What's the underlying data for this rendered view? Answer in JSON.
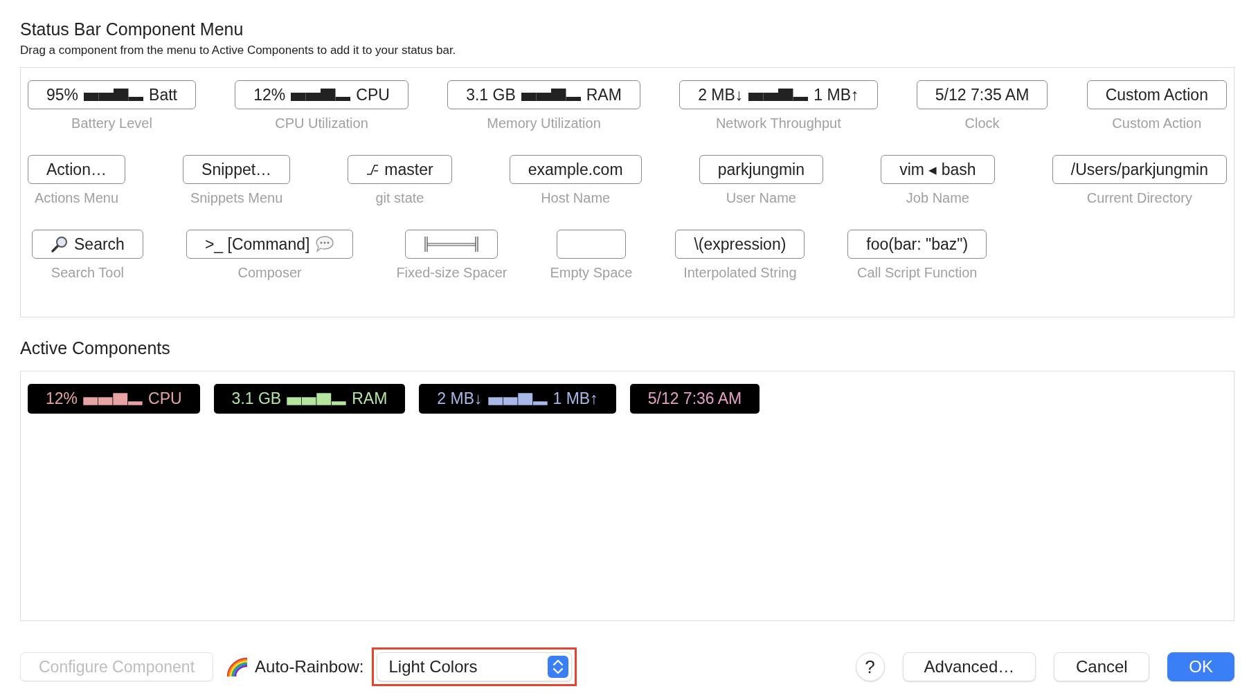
{
  "title": "Status Bar Component Menu",
  "subtitle": "Drag a component from the menu to Active Components to add it to your status bar.",
  "palette_rows": [
    {
      "items": [
        {
          "label": "Battery Level",
          "chip": [
            {
              "kind": "text",
              "text": "95%"
            },
            {
              "kind": "sparkline"
            },
            {
              "kind": "text",
              "text": "Batt"
            }
          ]
        },
        {
          "label": "CPU Utilization",
          "chip": [
            {
              "kind": "text",
              "text": "12%"
            },
            {
              "kind": "sparkline"
            },
            {
              "kind": "text",
              "text": "CPU"
            }
          ]
        },
        {
          "label": "Memory Utilization",
          "chip": [
            {
              "kind": "text",
              "text": "3.1 GB"
            },
            {
              "kind": "sparkline"
            },
            {
              "kind": "text",
              "text": "RAM"
            }
          ]
        },
        {
          "label": "Network Throughput",
          "chip": [
            {
              "kind": "text",
              "text": "2 MB↓"
            },
            {
              "kind": "sparkline"
            },
            {
              "kind": "text",
              "text": "1 MB↑"
            }
          ]
        },
        {
          "label": "Clock",
          "chip": [
            {
              "kind": "text",
              "text": "5/12 7:35 AM"
            }
          ]
        },
        {
          "label": "Custom Action",
          "chip": [
            {
              "kind": "text",
              "text": "Custom Action"
            }
          ]
        }
      ]
    },
    {
      "items": [
        {
          "label": "Actions Menu",
          "chip": [
            {
              "kind": "text",
              "text": "Action…"
            }
          ]
        },
        {
          "label": "Snippets Menu",
          "chip": [
            {
              "kind": "text",
              "text": "Snippet…"
            }
          ]
        },
        {
          "label": "git state",
          "chip": [
            {
              "kind": "branch"
            },
            {
              "kind": "text",
              "text": "master"
            }
          ]
        },
        {
          "label": "Host Name",
          "chip": [
            {
              "kind": "text",
              "text": "example.com"
            }
          ]
        },
        {
          "label": "User Name",
          "chip": [
            {
              "kind": "text",
              "text": "parkjungmin"
            }
          ]
        },
        {
          "label": "Job Name",
          "chip": [
            {
              "kind": "text",
              "text": "vim ◂ bash"
            }
          ]
        },
        {
          "label": "Current Directory",
          "chip": [
            {
              "kind": "text",
              "text": "/Users/parkjungmin"
            }
          ]
        }
      ]
    },
    {
      "items": [
        {
          "label": "Search Tool",
          "chip": [
            {
              "kind": "magnifier"
            },
            {
              "kind": "text",
              "text": "Search"
            }
          ]
        },
        {
          "label": "Composer",
          "chip": [
            {
              "kind": "text",
              "text": ">_ [Command]"
            },
            {
              "kind": "bubble"
            }
          ]
        },
        {
          "label": "Fixed-size Spacer",
          "chip": [
            {
              "kind": "ruler"
            }
          ]
        },
        {
          "label": "Empty Space"
        },
        {
          "label": "Interpolated String",
          "chip": [
            {
              "kind": "text",
              "text": "\\(expression)"
            }
          ]
        },
        {
          "label": "Call Script Function",
          "chip": [
            {
              "kind": "text",
              "text": "foo(bar: \"baz\")"
            }
          ]
        }
      ]
    }
  ],
  "active_title": "Active Components",
  "active": [
    {
      "color": "#e8a4a4",
      "chip": [
        {
          "kind": "text",
          "text": "12%"
        },
        {
          "kind": "sparkline"
        },
        {
          "kind": "text",
          "text": "CPU"
        }
      ]
    },
    {
      "color": "#b5e6a0",
      "chip": [
        {
          "kind": "text",
          "text": "3.1 GB"
        },
        {
          "kind": "sparkline"
        },
        {
          "kind": "text",
          "text": "RAM"
        }
      ]
    },
    {
      "color": "#a8b8e8",
      "chip": [
        {
          "kind": "text",
          "text": "2 MB↓"
        },
        {
          "kind": "sparkline"
        },
        {
          "kind": "text",
          "text": "1 MB↑"
        }
      ]
    },
    {
      "color": "#e8a0c8",
      "chip": [
        {
          "kind": "text",
          "text": "5/12 7:36 AM"
        }
      ]
    }
  ],
  "footer": {
    "configure": {
      "label": "Configure Component",
      "disabled": true
    },
    "rainbow_label": "Auto-Rainbow:",
    "rainbow_popup": {
      "value": "Light Colors",
      "highlighted": true
    },
    "buttons": [
      {
        "kind": "help",
        "label": "?"
      },
      {
        "kind": "normal",
        "label": "Advanced…"
      },
      {
        "kind": "normal",
        "label": "Cancel"
      },
      {
        "kind": "default",
        "label": "OK"
      }
    ]
  }
}
